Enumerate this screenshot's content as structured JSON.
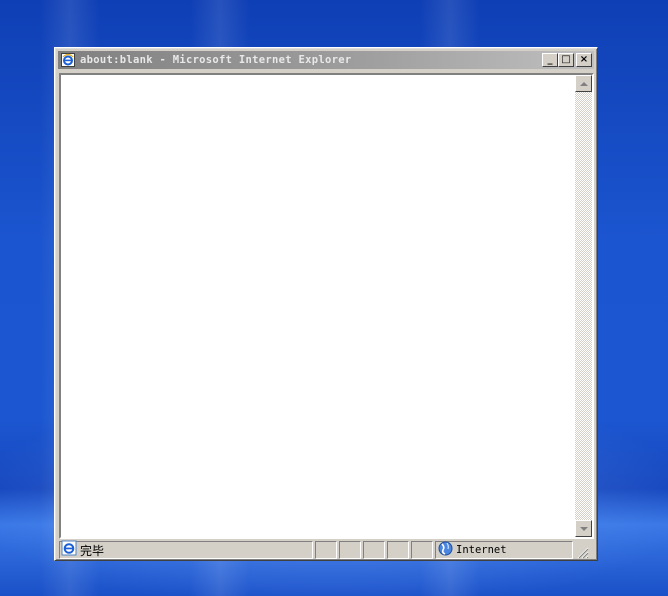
{
  "window": {
    "title": "about:blank - Microsoft Internet Explorer",
    "buttons": {
      "minimize": "_",
      "maximize": "□",
      "close": "×"
    }
  },
  "statusbar": {
    "status_text": "完毕",
    "zone_text": "Internet"
  },
  "icons": {
    "title": "ie-logo-icon",
    "status": "ie-page-icon",
    "zone": "internet-globe-icon"
  },
  "colors": {
    "desktop_blue": "#1c57d1",
    "titlebar_inactive": "#808080",
    "face": "#d4d0c8"
  }
}
